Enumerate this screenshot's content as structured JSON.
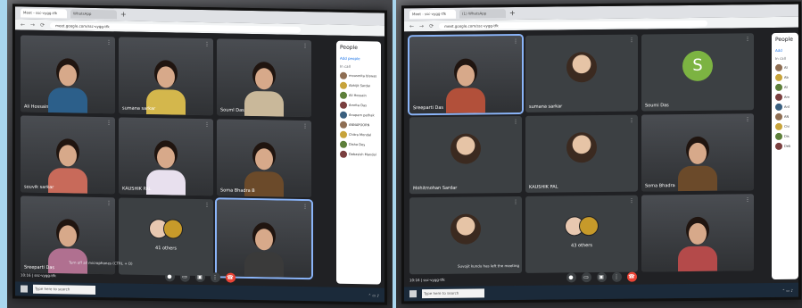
{
  "left": {
    "tabs": [
      "Meet - ssc-vygg-tfk",
      "WhatsApp"
    ],
    "url": "meet.google.com/ssc-vygg-tfk",
    "tiles": [
      {
        "name": "Ali Hossain",
        "kind": "person",
        "shirt": "#2c5f8a"
      },
      {
        "name": "sumana sarkar",
        "kind": "person",
        "shirt": "#d4b74c"
      },
      {
        "name": "Souml Das",
        "kind": "person",
        "shirt": "#c9b89a"
      },
      {
        "name": "souvik sarkar",
        "kind": "person",
        "shirt": "#c86a5a"
      },
      {
        "name": "KAUSHIK PAL",
        "kind": "person",
        "shirt": "#e8e0ee"
      },
      {
        "name": "Soma Bhadra B",
        "kind": "person",
        "shirt": "#6b4a2a"
      },
      {
        "name": "Sreeparti Das",
        "kind": "person",
        "shirt": "#b07090"
      },
      {
        "name": "41 others",
        "kind": "others"
      },
      {
        "name": "",
        "kind": "person",
        "shirt": "#3a3a3a",
        "active": true
      }
    ],
    "people_title": "People",
    "add_people": "Add people",
    "in_call": "In call",
    "participants": [
      "mousmita biswas",
      "Abhijit Sardar",
      "Ali Hossain",
      "Amrita Das",
      "Anupam pathak",
      "ANNAPOORN",
      "Chitra Mondal",
      "Disha Dey",
      "Debasish Mandal"
    ],
    "meeting_code": "10:16 | ssc-vygg-tfk",
    "caption": "Turn off all microphones (CTRL + D)"
  },
  "right": {
    "tabs": [
      "Meet - ssc-vygg-tfk",
      "(1) WhatsApp"
    ],
    "url": "meet.google.com/ssc-vygg-tfk",
    "tiles": [
      {
        "name": "Sreeparti Das",
        "kind": "person",
        "shirt": "#b2503a",
        "active": true
      },
      {
        "name": "sumana sarkar",
        "kind": "avatar-photo"
      },
      {
        "name": "Soumi Das",
        "kind": "letter",
        "letter": "S"
      },
      {
        "name": "Mohitmohan Sardar",
        "kind": "avatar-photo"
      },
      {
        "name": "KAUSHIK PAL",
        "kind": "avatar-photo"
      },
      {
        "name": "Soma Bhadra",
        "kind": "person",
        "shirt": "#6b4a2a"
      },
      {
        "name": "",
        "kind": "avatar-photo"
      },
      {
        "name": "43 others",
        "kind": "others"
      },
      {
        "name": "",
        "kind": "person",
        "shirt": "#b44a4a"
      }
    ],
    "people_title": "People",
    "add_people": "Add",
    "in_call": "In call",
    "participants": [
      "Ali",
      "Ab",
      "Ali",
      "Am",
      "Ant",
      "AN",
      "Chi",
      "Dis",
      "Deb"
    ],
    "meeting_code": "10:16 | ssc-vygg-tfk",
    "caption": "Suvojit kundu has left the meeting"
  },
  "taskbar_search": "Type here to search",
  "colors": {
    "meet_bg": "#202124",
    "active_outline": "#8ab4f8",
    "end_call": "#ea4335"
  }
}
